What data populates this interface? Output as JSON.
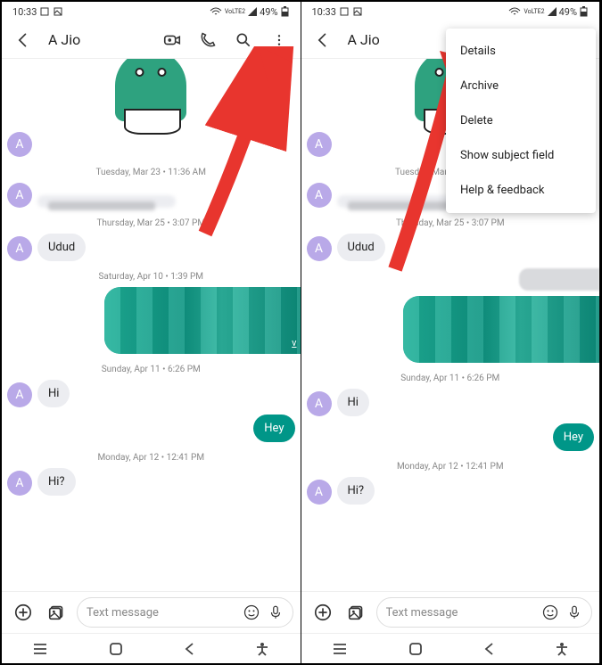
{
  "status": {
    "time": "10:33",
    "battery": "49%",
    "network": "VoLTE2"
  },
  "header": {
    "contact": "A Jio"
  },
  "timestamps": {
    "t1": "Tuesday, Mar 23 • 11:36 AM",
    "t2": "Thursday, Mar 25 • 3:07 PM",
    "t3": "Saturday, Apr 10 • 1:39 PM",
    "t4": "Sunday, Apr 11 • 6:26 PM",
    "t5": "Monday, Apr 12 • 12:41 PM"
  },
  "messages": {
    "m_udud": "Udud",
    "m_hi": "Hi",
    "m_hey": "Hey",
    "m_hi2": "Hi?",
    "blurred_v": "v"
  },
  "avatar_letter": "A",
  "composer": {
    "placeholder": "Text message"
  },
  "menu": {
    "details": "Details",
    "archive": "Archive",
    "delete": "Delete",
    "subject": "Show subject field",
    "help": "Help & feedback"
  }
}
